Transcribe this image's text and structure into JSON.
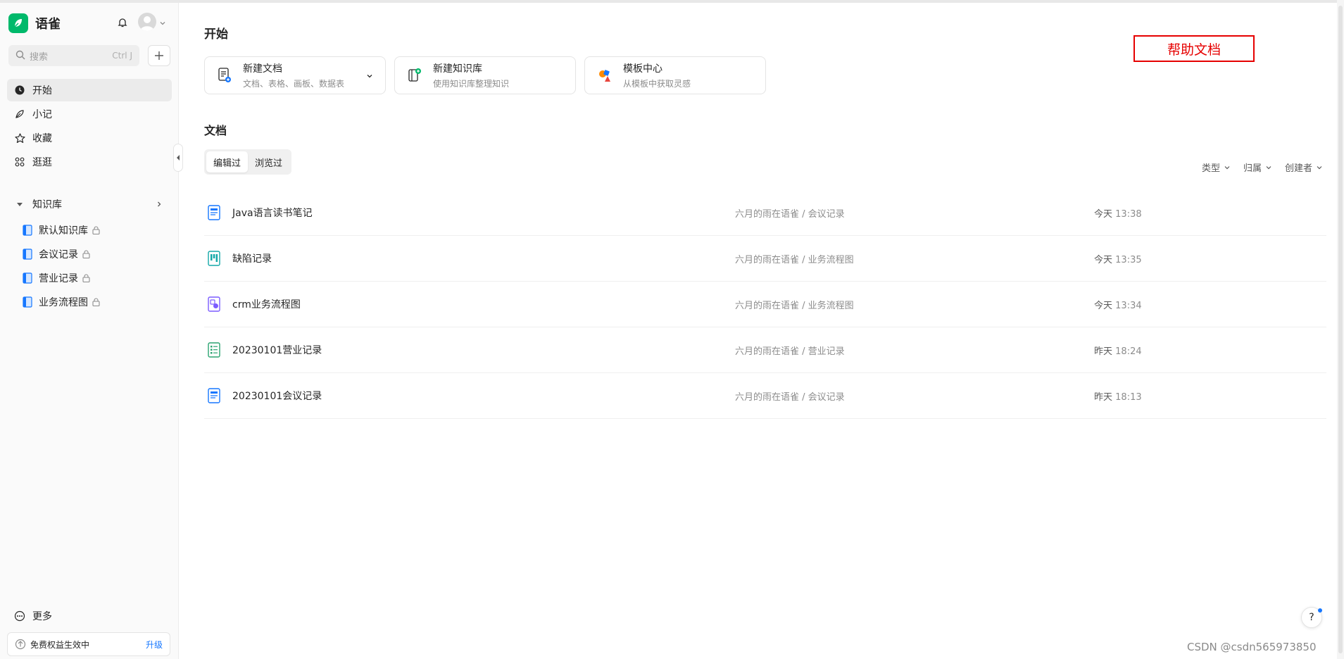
{
  "app": {
    "name": "语雀"
  },
  "search": {
    "placeholder": "搜索",
    "shortcut": "Ctrl J"
  },
  "nav": [
    {
      "label": "开始",
      "icon": "clock-icon",
      "active": true
    },
    {
      "label": "小记",
      "icon": "feather-icon",
      "active": false
    },
    {
      "label": "收藏",
      "icon": "star-icon",
      "active": false
    },
    {
      "label": "逛逛",
      "icon": "grid-icon",
      "active": false
    }
  ],
  "knowledge_base": {
    "label": "知识库",
    "items": [
      {
        "label": "默认知识库"
      },
      {
        "label": "会议记录"
      },
      {
        "label": "营业记录"
      },
      {
        "label": "业务流程图"
      }
    ]
  },
  "sidebar_bottom": {
    "more_label": "更多",
    "benefit_text": "免费权益生效中",
    "upgrade_label": "升级"
  },
  "main": {
    "title": "开始",
    "cards": [
      {
        "title": "新建文档",
        "subtitle": "文档、表格、画板、数据表"
      },
      {
        "title": "新建知识库",
        "subtitle": "使用知识库整理知识"
      },
      {
        "title": "模板中心",
        "subtitle": "从模板中获取灵感"
      }
    ],
    "help_annotation": "帮助文档",
    "docs_title": "文档",
    "tabs": [
      {
        "label": "编辑过",
        "active": true
      },
      {
        "label": "浏览过",
        "active": false
      }
    ],
    "filters": [
      {
        "label": "类型"
      },
      {
        "label": "归属"
      },
      {
        "label": "创建者"
      }
    ],
    "docs": [
      {
        "title": "Java语言读书笔记",
        "path": "六月的雨在语雀 / 会议记录",
        "day": "今天",
        "time": "13:38",
        "icon": "doc-icon"
      },
      {
        "title": "缺陷记录",
        "path": "六月的雨在语雀 / 业务流程图",
        "day": "今天",
        "time": "13:35",
        "icon": "board-icon"
      },
      {
        "title": "crm业务流程图",
        "path": "六月的雨在语雀 / 业务流程图",
        "day": "今天",
        "time": "13:34",
        "icon": "drawing-icon"
      },
      {
        "title": "20230101营业记录",
        "path": "六月的雨在语雀 / 营业记录",
        "day": "昨天",
        "time": "18:24",
        "icon": "sheet-icon"
      },
      {
        "title": "20230101会议记录",
        "path": "六月的雨在语雀 / 会议记录",
        "day": "昨天",
        "time": "18:13",
        "icon": "doc-icon"
      }
    ],
    "help_fab": "?"
  },
  "watermark": "CSDN @csdn565973850",
  "colors": {
    "brand": "#00b96b",
    "accent": "#1677ff",
    "annotation": "#e60000"
  }
}
